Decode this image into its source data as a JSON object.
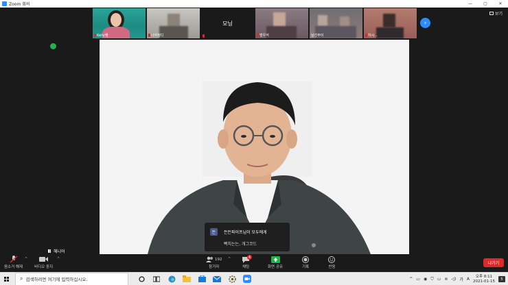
{
  "window": {
    "title": "Zoom 회의",
    "minimize": "—",
    "maximize": "▢",
    "close": "✕"
  },
  "view_button": {
    "label": "보기"
  },
  "thumbnails": [
    {
      "name": "Kelly쌤",
      "muted": true
    },
    {
      "name": "나하정디",
      "muted": true
    },
    {
      "name": "모닝",
      "muted": true,
      "video_off": true
    },
    {
      "name": "범우석",
      "muted": true
    },
    {
      "name": "날선주이",
      "muted": false
    },
    {
      "name": "차시...",
      "muted": true
    }
  ],
  "speaker": {
    "label": "헤니어"
  },
  "chat_popup": {
    "avatar_letter": "든",
    "from": "든든파이프님이 모두에게",
    "message": "빡치는는, 개그코드"
  },
  "controls": {
    "mute": "음소거 해제",
    "video": "비디오 중지",
    "participants": "참가자",
    "participants_count": "192",
    "chat": "채팅",
    "chat_badge": "4",
    "share": "화면 공유",
    "record": "기록",
    "reactions": "반응",
    "leave": "나가기"
  },
  "taskbar": {
    "search_placeholder": "검색하려면 여기에 입력하십시오.",
    "ime": "가",
    "ime_lang": "A",
    "time": "오후 8:11",
    "date": "2021-01-15",
    "notification_count": "5"
  },
  "colors": {
    "accent": "#2d8cff",
    "leave": "#e02828",
    "share": "#23b14d",
    "muted_mic": "#e02828"
  }
}
